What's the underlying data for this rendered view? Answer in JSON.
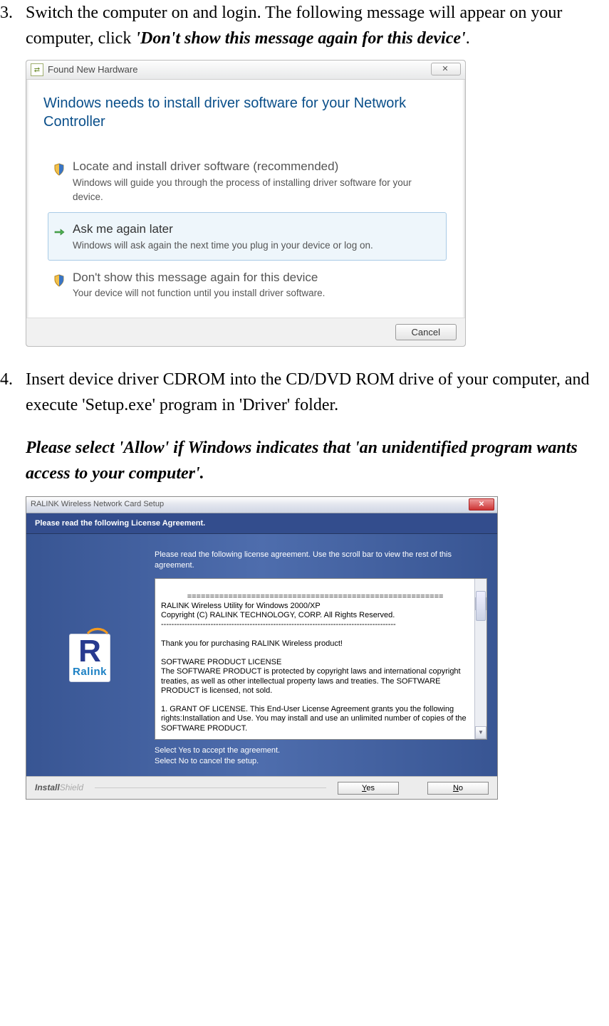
{
  "step3": {
    "number": "3.",
    "pre": "Switch the computer on and login. The following message will appear on your computer, click ",
    "bold": "'Don't show this message again for this device'",
    "post": "."
  },
  "vista": {
    "title": "Found New Hardware",
    "close_glyph": "✕",
    "heading": "Windows needs to install driver software for your Network Controller",
    "options": [
      {
        "title": "Locate and install driver software (recommended)",
        "desc": "Windows will guide you through the process of installing driver software for your device."
      },
      {
        "title": "Ask me again later",
        "desc": "Windows will ask again the next time you plug in your device or log on."
      },
      {
        "title": "Don't show this message again for this device",
        "desc": "Your device will not function until you install driver software."
      }
    ],
    "cancel": "Cancel"
  },
  "step4": {
    "number": "4.",
    "p1": "Insert device driver CDROM into the CD/DVD ROM drive of your computer, and execute 'Setup.exe' program in 'Driver' folder.",
    "p2": "Please select 'Allow' if Windows indicates that 'an unidentified program wants access to your computer'."
  },
  "is": {
    "title": "RALINK Wireless Network Card Setup",
    "header": "Please read the following License Agreement.",
    "intro": "Please read the following license agreement. Use the scroll bar to view the rest of this agreement.",
    "license": "========================================================\nRALINK Wireless Utility for Windows 2000/XP\nCopyright (C) RALINK TECHNOLOGY, CORP. All Rights Reserved.\n------------------------------------------------------------------------------------------\n\nThank you for purchasing RALINK Wireless product!\n\nSOFTWARE PRODUCT LICENSE\nThe SOFTWARE PRODUCT is protected by copyright laws and international copyright treaties, as well as other intellectual property laws and treaties. The SOFTWARE PRODUCT is licensed, not sold.\n\n1. GRANT OF LICENSE. This End-User License Agreement grants you the following rights:Installation and Use. You may install and use an unlimited number of copies of the SOFTWARE PRODUCT.\n\nReproduction and Distribution. You may reproduce and distribute an unlimited number of copies of the SOFTWARE PRODUCT; provided that each copy shall be a true and complete",
    "accept1": "Select Yes to accept the agreement.",
    "accept2": "Select No to cancel the setup.",
    "brand_bold": "Install",
    "brand_light": "Shield",
    "yes_u": "Y",
    "yes_rest": "es",
    "no_u": "N",
    "no_rest": "o",
    "logo_word": "Ralink"
  }
}
